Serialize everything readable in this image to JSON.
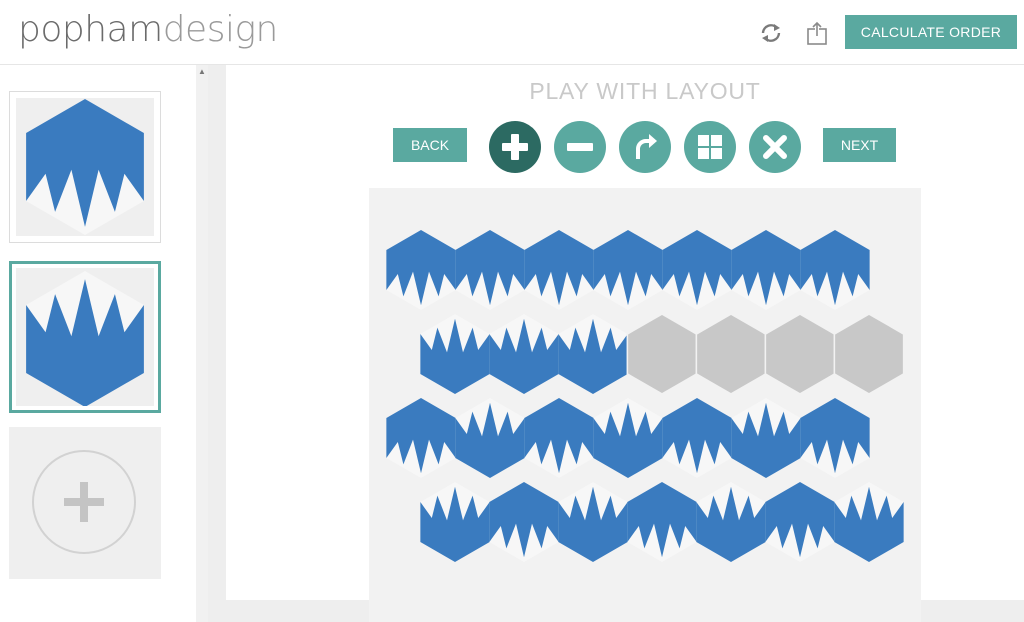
{
  "header": {
    "logo_part1": "popham",
    "logo_part2": "design",
    "calculate_label": "CALCULATE ORDER",
    "icons": [
      "refresh-icon",
      "share-icon"
    ]
  },
  "sidebar": {
    "tiles": [
      {
        "name": "tile-design-1",
        "selected": false
      },
      {
        "name": "tile-design-2",
        "selected": true
      },
      {
        "name": "add-tile",
        "icon": "plus-icon"
      }
    ]
  },
  "main": {
    "title": "PLAY WITH LAYOUT",
    "back_label": "BACK",
    "next_label": "NEXT",
    "tools": [
      "add-icon",
      "remove-icon",
      "rotate-icon",
      "grid-icon",
      "close-icon"
    ]
  },
  "colors": {
    "accent": "#5aa9a0",
    "accent_dark": "#2c6a62",
    "tile_blue": "#3a7bbf",
    "tile_white": "#f7f7f7",
    "empty_cell": "#c8c8c8"
  }
}
